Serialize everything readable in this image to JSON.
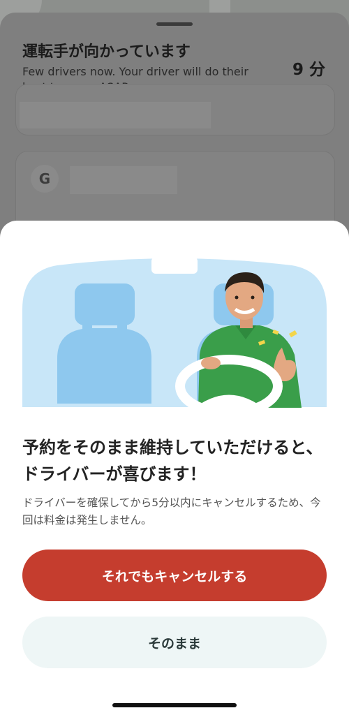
{
  "background_sheet": {
    "title": "運転手が向かっています",
    "description": "Few drivers now. Your driver will do their best to come ASAP.",
    "eta": "9 分",
    "payment_icon_letter": "G"
  },
  "modal": {
    "title": "予約をそのまま維持していただけると、ドライバーが喜びます！",
    "body": "ドライバーを確保してから5分以内にキャンセルするため、今回は料金は発生しません。",
    "cancel_button": "それでもキャンセルする",
    "keep_button": "そのまま"
  },
  "colors": {
    "primary_red": "#c53d2e",
    "secondary_button_bg": "#eef6f6",
    "illustration_sky": "#c8e6f8",
    "driver_shirt": "#3a9e4a"
  },
  "icons": [
    "google-icon",
    "driver-illustration"
  ]
}
